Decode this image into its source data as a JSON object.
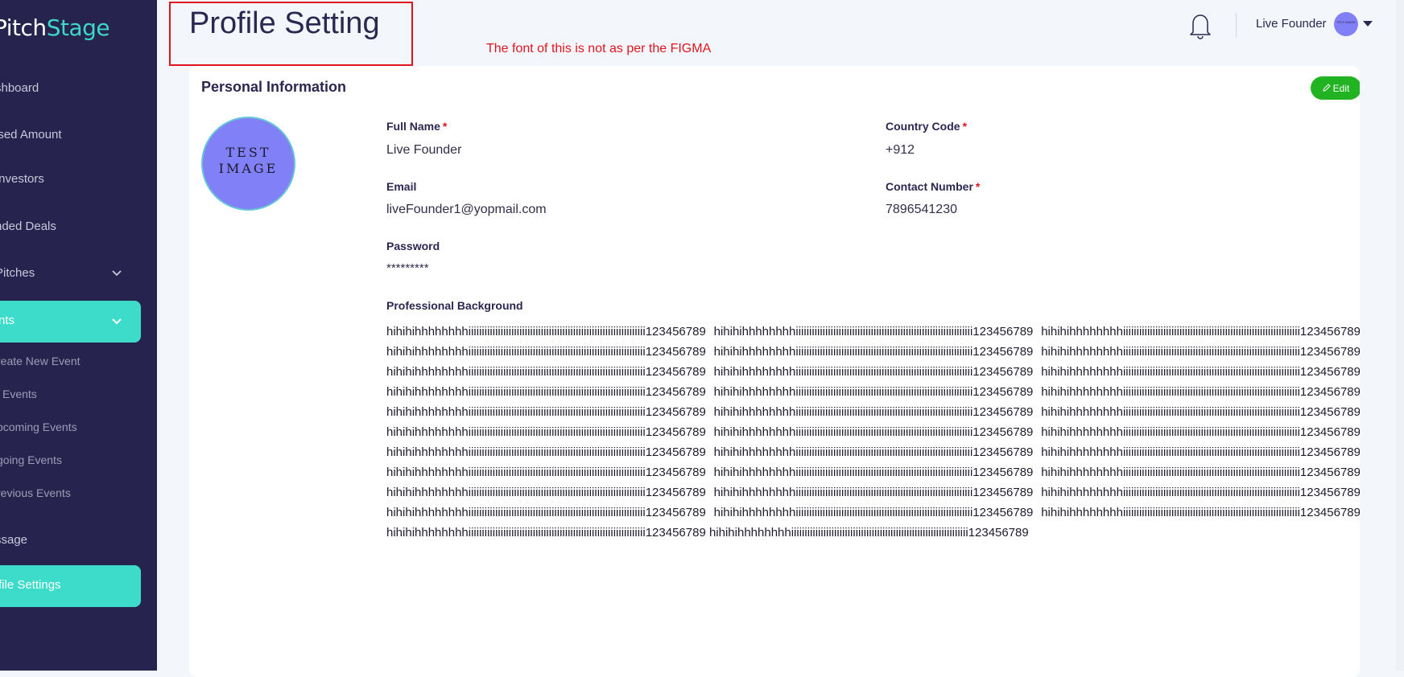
{
  "brand": {
    "logo_main": "itch",
    "logo_accent": "Stage",
    "logo_lead": "P"
  },
  "sidebar": {
    "items": [
      {
        "label": "shboard"
      },
      {
        "label": "ised Amount"
      },
      {
        "label": "Investors"
      },
      {
        "label": "nded Deals"
      },
      {
        "label": "Pitches"
      },
      {
        "label": "nts"
      },
      {
        "label": "reate New Event"
      },
      {
        "label": "l Events"
      },
      {
        "label": "pcoming Events"
      },
      {
        "label": "going Events"
      },
      {
        "label": "revious Events"
      },
      {
        "label": "ssage"
      },
      {
        "label": "file Settings"
      }
    ]
  },
  "header": {
    "title": "Profile Setting",
    "annotation": "The font of this is not as per the FIGMA",
    "user_name": "Live Founder",
    "avatar_text": "TEST IMAGE"
  },
  "card": {
    "title": "Personal Information",
    "edit_label": "Edit",
    "avatar_text_line1": "TEST",
    "avatar_text_line2": "IMAGE",
    "fields": {
      "full_name": {
        "label": "Full Name",
        "value": "Live Founder",
        "required": "*"
      },
      "country_code": {
        "label": "Country Code",
        "value": "+912",
        "required": "*"
      },
      "email": {
        "label": "Email",
        "value": "liveFounder1@yopmail.com"
      },
      "contact_number": {
        "label": "Contact Number",
        "value": "7896541230",
        "required": "*"
      },
      "password": {
        "label": "Password",
        "value": "*********"
      },
      "professional_background": {
        "label": "Professional Background",
        "value": "hihihihhhhhhhhiiiiiiiiiiiiiiiiiiiiiiiiiiiiiiiiiiiiiiiiiiiiiiiiiiiiiiiiiiiiiiiiii123456789 hihihihhhhhhhhiiiiiiiiiiiiiiiiiiiiiiiiiiiiiiiiiiiiiiiiiiiiiiiiiiiiiiiiiiiiiiiiii123456789 hihihihhhhhhhhiiiiiiiiiiiiiiiiiiiiiiiiiiiiiiiiiiiiiiiiiiiiiiiiiiiiiiiiiiiiiiiiii123456789 hihihihhhhhhhhiiiiiiiiiiiiiiiiiiiiiiiiiiiiiiiiiiiiiiiiiiiiiiiiiiiiiiiiiiiiiiiiii123456789 hihihihhhhhhhhiiiiiiiiiiiiiiiiiiiiiiiiiiiiiiiiiiiiiiiiiiiiiiiiiiiiiiiiiiiiiiiiii123456789 hihihihhhhhhhhiiiiiiiiiiiiiiiiiiiiiiiiiiiiiiiiiiiiiiiiiiiiiiiiiiiiiiiiiiiiiiiiii123456789 hihihihhhhhhhhiiiiiiiiiiiiiiiiiiiiiiiiiiiiiiiiiiiiiiiiiiiiiiiiiiiiiiiiiiiiiiiiii123456789 hihihihhhhhhhhiiiiiiiiiiiiiiiiiiiiiiiiiiiiiiiiiiiiiiiiiiiiiiiiiiiiiiiiiiiiiiiiii123456789 hihihihhhhhhhhiiiiiiiiiiiiiiiiiiiiiiiiiiiiiiiiiiiiiiiiiiiiiiiiiiiiiiiiiiiiiiiiii123456789 hihihihhhhhhhhiiiiiiiiiiiiiiiiiiiiiiiiiiiiiiiiiiiiiiiiiiiiiiiiiiiiiiiiiiiiiiiiii123456789 hihihihhhhhhhhiiiiiiiiiiiiiiiiiiiiiiiiiiiiiiiiiiiiiiiiiiiiiiiiiiiiiiiiiiiiiiiiii123456789 hihihihhhhhhhhiiiiiiiiiiiiiiiiiiiiiiiiiiiiiiiiiiiiiiiiiiiiiiiiiiiiiiiiiiiiiiiiii123456789 hihihihhhhhhhhiiiiiiiiiiiiiiiiiiiiiiiiiiiiiiiiiiiiiiiiiiiiiiiiiiiiiiiiiiiiiiiiii123456789 hihihihhhhhhhhiiiiiiiiiiiiiiiiiiiiiiiiiiiiiiiiiiiiiiiiiiiiiiiiiiiiiiiiiiiiiiiiii123456789 hihihihhhhhhhhiiiiiiiiiiiiiiiiiiiiiiiiiiiiiiiiiiiiiiiiiiiiiiiiiiiiiiiiiiiiiiiiii123456789 hihihihhhhhhhhiiiiiiiiiiiiiiiiiiiiiiiiiiiiiiiiiiiiiiiiiiiiiiiiiiiiiiiiiiiiiiiiii123456789 hihihihhhhhhhhiiiiiiiiiiiiiiiiiiiiiiiiiiiiiiiiiiiiiiiiiiiiiiiiiiiiiiiiiiiiiiiiii123456789 hihihihhhhhhhhiiiiiiiiiiiiiiiiiiiiiiiiiiiiiiiiiiiiiiiiiiiiiiiiiiiiiiiiiiiiiiiiii123456789 hihihihhhhhhhhiiiiiiiiiiiiiiiiiiiiiiiiiiiiiiiiiiiiiiiiiiiiiiiiiiiiiiiiiiiiiiiiii123456789 hihihihhhhhhhhiiiiiiiiiiiiiiiiiiiiiiiiiiiiiiiiiiiiiiiiiiiiiiiiiiiiiiiiiiiiiiiiii123456789 hihihihhhhhhhhiiiiiiiiiiiiiiiiiiiiiiiiiiiiiiiiiiiiiiiiiiiiiiiiiiiiiiiiiiiiiiiiii123456789 hihihihhhhhhhhiiiiiiiiiiiiiiiiiiiiiiiiiiiiiiiiiiiiiiiiiiiiiiiiiiiiiiiiiiiiiiiiii123456789 hihihihhhhhhhhiiiiiiiiiiiiiiiiiiiiiiiiiiiiiiiiiiiiiiiiiiiiiiiiiiiiiiiiiiiiiiiiii123456789 hihihihhhhhhhhiiiiiiiiiiiiiiiiiiiiiiiiiiiiiiiiiiiiiiiiiiiiiiiiiiiiiiiiiiiiiiiiii123456789 hihihihhhhhhhhiiiiiiiiiiiiiiiiiiiiiiiiiiiiiiiiiiiiiiiiiiiiiiiiiiiiiiiiiiiiiiiiii123456789 hihihihhhhhhhhiiiiiiiiiiiiiiiiiiiiiiiiiiiiiiiiiiiiiiiiiiiiiiiiiiiiiiiiiiiiiiiiii123456789 hihihihhhhhhhhiiiiiiiiiiiiiiiiiiiiiiiiiiiiiiiiiiiiiiiiiiiiiiiiiiiiiiiiiiiiiiiiii123456789 hihihihhhhhhhhiiiiiiiiiiiiiiiiiiiiiiiiiiiiiiiiiiiiiiiiiiiiiiiiiiiiiiiiiiiiiiiiii123456789 hihihihhhhhhhhiiiiiiiiiiiiiiiiiiiiiiiiiiiiiiiiiiiiiiiiiiiiiiiiiiiiiiiiiiiiiiiiii123456789 hihihihhhhhhhhiiiiiiiiiiiiiiiiiiiiiiiiiiiiiiiiiiiiiiiiiiiiiiiiiiiiiiiiiiiiiiiiii123456789 hihihihhhhhhhhiiiiiiiiiiiiiiiiiiiiiiiiiiiiiiiiiiiiiiiiiiiiiiiiiiiiiiiiiiiiiiiiii123456789 hihihihhhhhhhhiiiiiiiiiiiiiiiiiiiiiiiiiiiiiiiiiiiiiiiiiiiiiiiiiiiiiiiiiiiiiiiiii123456789"
      }
    }
  },
  "colors": {
    "sidebar_bg": "#26234e",
    "accent_teal": "#3ddbc9",
    "edit_green": "#21b321",
    "annotation_red": "#e0141d",
    "avatar_purple": "#8280f7"
  },
  "icons": {
    "bell": "bell-icon",
    "caret": "caret-down-icon",
    "chevron": "chevron-down-icon",
    "pencil": "pencil-icon"
  }
}
